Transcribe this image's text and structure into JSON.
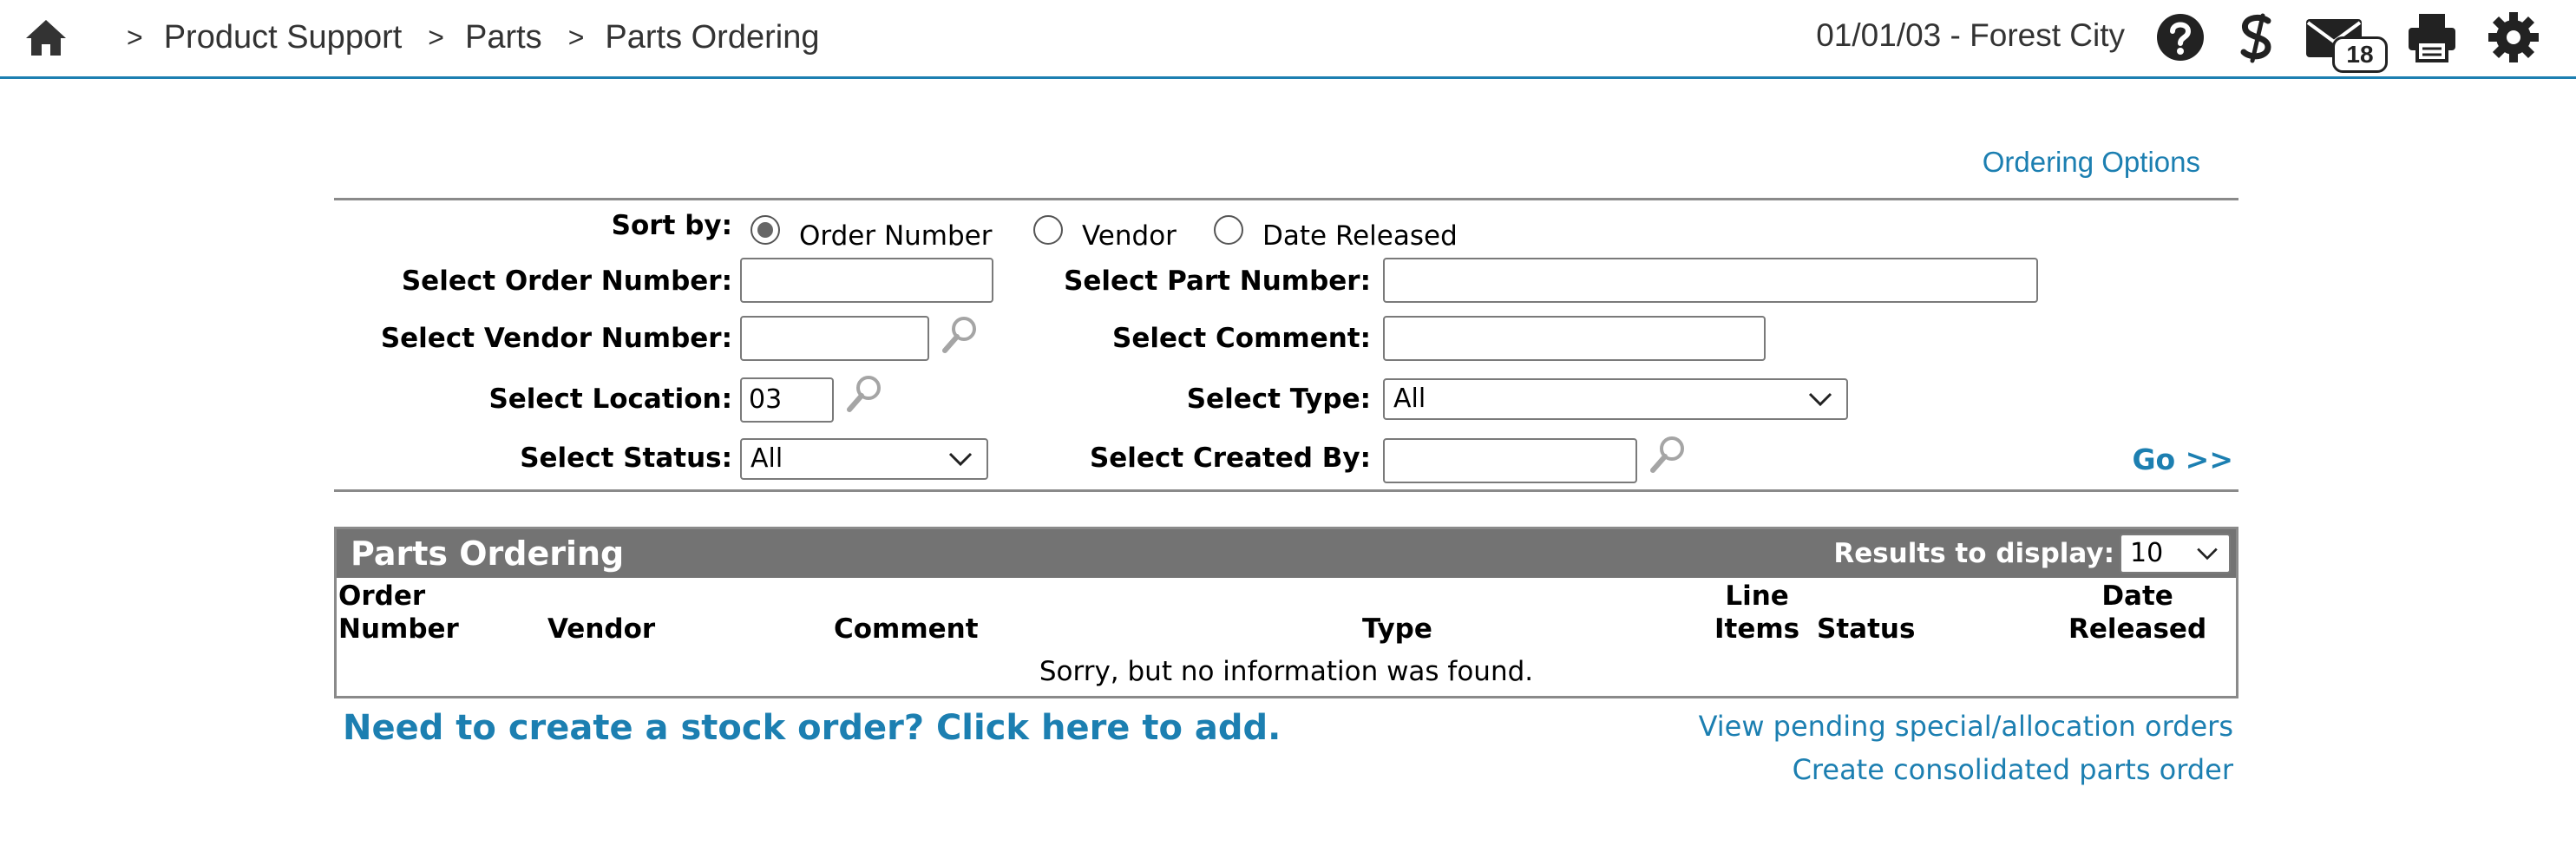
{
  "header": {
    "breadcrumbs": [
      "Product Support",
      "Parts",
      "Parts Ordering"
    ],
    "breadcrumb_separator": ">",
    "date_location": "01/01/03 - Forest City",
    "mail_count": "18",
    "icons": [
      "home-icon",
      "help-icon",
      "s-logo-icon",
      "mail-icon",
      "print-icon",
      "gear-icon"
    ],
    "accent_color": "#1c7fb1"
  },
  "ordering_options_link": "Ordering Options",
  "filters": {
    "sort_by_label": "Sort by:",
    "sort_options": [
      "Order Number",
      "Vendor",
      "Date Released"
    ],
    "sort_selected": "Order Number",
    "order_number_label": "Select Order Number:",
    "order_number_value": "",
    "part_number_label": "Select Part Number:",
    "part_number_value": "",
    "vendor_number_label": "Select Vendor Number:",
    "vendor_number_value": "",
    "comment_label": "Select Comment:",
    "comment_value": "",
    "location_label": "Select Location:",
    "location_value": "03",
    "type_label": "Select Type:",
    "type_value": "All",
    "status_label": "Select Status:",
    "status_value": "All",
    "created_by_label": "Select Created By:",
    "created_by_value": "",
    "go_label": "Go >>"
  },
  "results": {
    "title": "Parts Ordering",
    "results_to_display_label": "Results to display:",
    "results_to_display_value": "10",
    "columns": [
      [
        "Order",
        "Number"
      ],
      [
        "",
        "Vendor"
      ],
      [
        "",
        "Comment"
      ],
      [
        "",
        "Type"
      ],
      [
        "Line",
        "Items"
      ],
      [
        "",
        "Status"
      ],
      [
        "Date",
        "Released"
      ]
    ],
    "empty_message": "Sorry, but no information was found."
  },
  "links": {
    "stock_order": "Need to create a stock order? Click here to add.",
    "pending_orders": "View pending special/allocation orders",
    "consolidated_order": "Create consolidated parts order"
  }
}
